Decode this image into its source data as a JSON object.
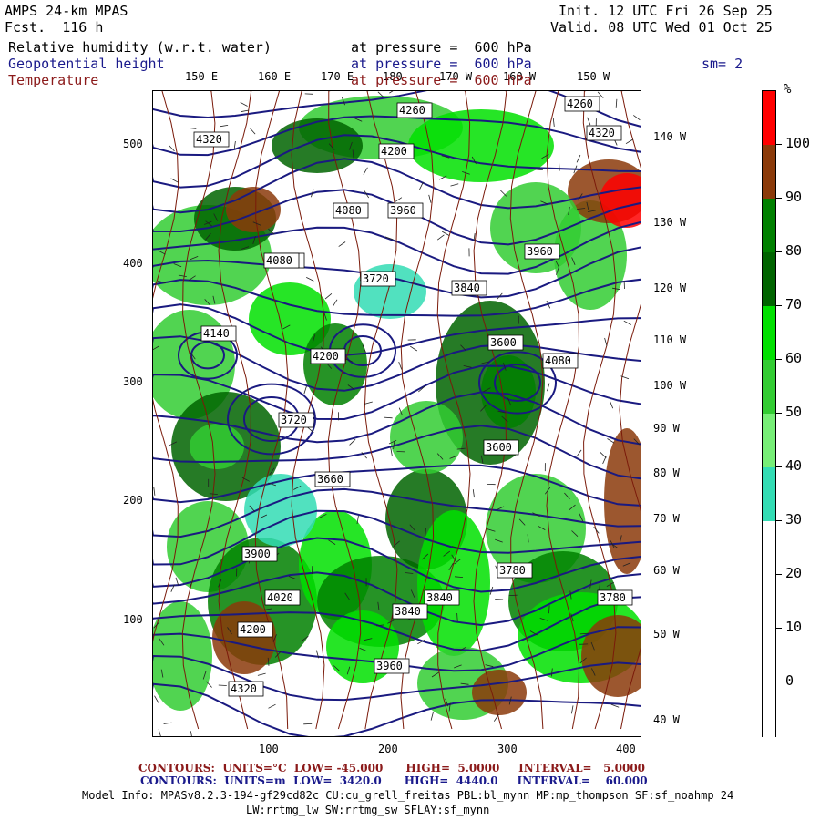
{
  "header": {
    "model": "AMPS 24-km MPAS",
    "fcst": "Fcst.  116 h",
    "init": "Init. 12 UTC Fri 26 Sep 25",
    "valid": "Valid. 08 UTC Wed 01 Oct 25"
  },
  "fields": {
    "rh_name": "Relative humidity (w.r.t. water)",
    "rh_level": "at pressure =  600 hPa",
    "gph_name": "Geopotential height",
    "gph_level": "at pressure =  600 hPa",
    "sm": "sm= 2",
    "temp_name": "Temperature",
    "temp_level": "at pressure =  600 hPa"
  },
  "colors": {
    "field_text": "#1a1a8c",
    "temp_text": "#8b1a1a",
    "height_contour": "#1a1a80",
    "temp_contour": "#7a1a0a"
  },
  "longitude_top": [
    "150 E",
    "160 E",
    "170 E",
    "180",
    "170 W",
    "160 W",
    "150 W"
  ],
  "longitude_right": [
    "140 W",
    "130 W",
    "120 W",
    "110 W",
    "100 W",
    "90 W",
    "80 W",
    "70 W",
    "60 W",
    "50 W",
    "40 W"
  ],
  "y_ticks": [
    "500",
    "400",
    "300",
    "200",
    "100"
  ],
  "x_ticks": [
    "100",
    "200",
    "300",
    "400"
  ],
  "height_labels": [
    "4320",
    "4260",
    "4260",
    "4320",
    "4320",
    "4200",
    "4080",
    "3960",
    "3840",
    "3780",
    "3720",
    "3600",
    "3900",
    "4020",
    "4140",
    "4080",
    "3840",
    "3960",
    "4200",
    "4320",
    "4200",
    "4080",
    "3960",
    "3840",
    "3780",
    "3720",
    "3660",
    "3600"
  ],
  "colorbar": {
    "unit": "%",
    "labels": [
      "100",
      "90",
      "80",
      "70",
      "60",
      "50",
      "40",
      "30",
      "20",
      "10",
      "0"
    ],
    "bins": [
      {
        "color": "#ff0000"
      },
      {
        "color": "#8b3a0a"
      },
      {
        "color": "#008000"
      },
      {
        "color": "#006400"
      },
      {
        "color": "#00e000"
      },
      {
        "color": "#33cc33"
      },
      {
        "color": "#77ee77"
      },
      {
        "color": "#33dcb4"
      },
      {
        "color": "#ffffff"
      },
      {
        "color": "#ffffff"
      },
      {
        "color": "#ffffff"
      },
      {
        "color": "#ffffff"
      }
    ]
  },
  "footer": {
    "temp_line": "CONTOURS:  UNITS=°C  LOW= -45.000      HIGH=  5.0000     INTERVAL=   5.0000",
    "height_line": "CONTOURS:  UNITS=m  LOW=  3420.0      HIGH=  4440.0     INTERVAL=    60.000",
    "model_info_1": "Model Info: MPASv8.2.3-194-gf29cd82c CU:cu_grell_freitas PBL:bl_mynn MP:mp_thompson SF:sf_noahmp 24",
    "model_info_2": "LW:rrtmg_lw SW:rrtmg_sw SFLAY:sf_mynn"
  }
}
